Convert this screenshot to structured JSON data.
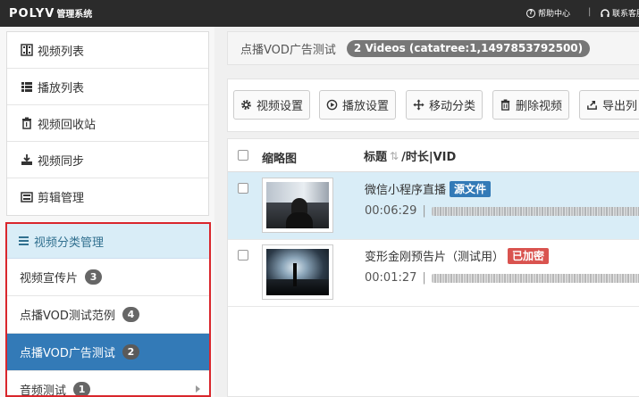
{
  "topbar": {
    "brand": "POLYV",
    "system": "管理系统",
    "help_label": "帮助中心",
    "separator": "|",
    "support_label": "联系客服"
  },
  "sidebar": {
    "items": [
      {
        "label": "视频列表",
        "icon": "film-icon"
      },
      {
        "label": "播放列表",
        "icon": "list-icon"
      },
      {
        "label": "视频回收站",
        "icon": "trash-icon"
      },
      {
        "label": "视频同步",
        "icon": "sync-icon"
      },
      {
        "label": "剪辑管理",
        "icon": "edit-icon"
      }
    ],
    "category": {
      "header": "视频分类管理",
      "items": [
        {
          "label": "视频宣传片",
          "count": "3"
        },
        {
          "label": "点播VOD测试范例",
          "count": "4"
        },
        {
          "label": "点播VOD广告测试",
          "count": "2",
          "active": true
        },
        {
          "label": "音频测试",
          "count": "1"
        }
      ]
    }
  },
  "breadcrumb": {
    "title": "点播VOD广告测试",
    "badge": "2 Videos (catatree:1,1497853792500)"
  },
  "toolbar": {
    "video_settings": "视频设置",
    "play_settings": "播放设置",
    "move_category": "移动分类",
    "delete_video": "删除视频",
    "export": "导出列"
  },
  "table": {
    "col_thumb": "缩略图",
    "col_title": "标题",
    "col_rest": "/时长|VID",
    "rows": [
      {
        "title": "微信小程序直播",
        "tag": "源文件",
        "duration": "00:06:29",
        "sep": "|"
      },
      {
        "title": "变形金刚预告片（测试用）",
        "tag": "已加密",
        "duration": "00:01:27",
        "sep": "|"
      }
    ]
  },
  "colors": {
    "accent": "#337ab7",
    "danger": "#d9534f",
    "highlight": "#d9edf7",
    "topbar": "#2b2b2b"
  }
}
